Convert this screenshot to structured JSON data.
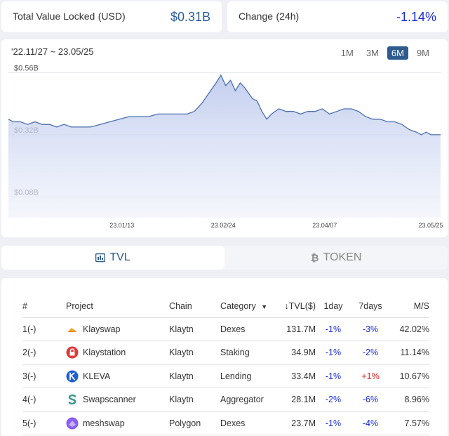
{
  "stats": {
    "tvl_label": "Total Value Locked",
    "tvl_unit": "(USD)",
    "tvl_value": "$0.31B",
    "change_label": "Change",
    "change_unit": "(24h)",
    "change_value": "-1.14%"
  },
  "chart": {
    "range_label": "'22.11/27 ~ 23.05/25",
    "periods": [
      "1M",
      "3M",
      "6M",
      "9M"
    ],
    "active_period": "6M",
    "accent": "#2d5b8f"
  },
  "chart_data": {
    "type": "area",
    "y_tick_labels": [
      "$0.56B",
      "$0.32B",
      "$0.08B"
    ],
    "y_ticks": [
      0.56,
      0.32,
      0.08
    ],
    "x_tick_labels": [
      "23.01/13",
      "23.02/24",
      "23.04/07",
      "23.05/25"
    ],
    "x_ticks": [
      "2023-01-13",
      "2023-02-24",
      "2023-04-07",
      "2023-05-25"
    ],
    "xlim": [
      "2022-11-27",
      "2023-05-25"
    ],
    "ylim": [
      0.0,
      0.58
    ],
    "grid": "horizontal",
    "series": [
      {
        "values": [
          [
            "2022-11-27",
            0.38
          ],
          [
            "2022-11-29",
            0.37
          ],
          [
            "2022-12-02",
            0.37
          ],
          [
            "2022-12-05",
            0.36
          ],
          [
            "2022-12-08",
            0.37
          ],
          [
            "2022-12-11",
            0.36
          ],
          [
            "2022-12-14",
            0.36
          ],
          [
            "2022-12-17",
            0.35
          ],
          [
            "2022-12-20",
            0.36
          ],
          [
            "2022-12-23",
            0.35
          ],
          [
            "2022-12-27",
            0.35
          ],
          [
            "2022-12-31",
            0.35
          ],
          [
            "2023-01-04",
            0.36
          ],
          [
            "2023-01-08",
            0.37
          ],
          [
            "2023-01-12",
            0.38
          ],
          [
            "2023-01-16",
            0.39
          ],
          [
            "2023-01-20",
            0.39
          ],
          [
            "2023-01-24",
            0.39
          ],
          [
            "2023-01-28",
            0.4
          ],
          [
            "2023-02-01",
            0.4
          ],
          [
            "2023-02-05",
            0.4
          ],
          [
            "2023-02-09",
            0.4
          ],
          [
            "2023-02-12",
            0.41
          ],
          [
            "2023-02-15",
            0.44
          ],
          [
            "2023-02-18",
            0.48
          ],
          [
            "2023-02-21",
            0.52
          ],
          [
            "2023-02-23",
            0.55
          ],
          [
            "2023-02-25",
            0.51
          ],
          [
            "2023-02-27",
            0.53
          ],
          [
            "2023-03-01",
            0.49
          ],
          [
            "2023-03-03",
            0.52
          ],
          [
            "2023-03-05",
            0.5
          ],
          [
            "2023-03-08",
            0.46
          ],
          [
            "2023-03-10",
            0.45
          ],
          [
            "2023-03-12",
            0.41
          ],
          [
            "2023-03-14",
            0.38
          ],
          [
            "2023-03-16",
            0.4
          ],
          [
            "2023-03-19",
            0.42
          ],
          [
            "2023-03-22",
            0.41
          ],
          [
            "2023-03-25",
            0.41
          ],
          [
            "2023-03-28",
            0.4
          ],
          [
            "2023-03-31",
            0.41
          ],
          [
            "2023-04-03",
            0.41
          ],
          [
            "2023-04-06",
            0.42
          ],
          [
            "2023-04-09",
            0.4
          ],
          [
            "2023-04-12",
            0.41
          ],
          [
            "2023-04-15",
            0.42
          ],
          [
            "2023-04-18",
            0.42
          ],
          [
            "2023-04-21",
            0.41
          ],
          [
            "2023-04-24",
            0.39
          ],
          [
            "2023-04-27",
            0.38
          ],
          [
            "2023-04-30",
            0.38
          ],
          [
            "2023-05-03",
            0.37
          ],
          [
            "2023-05-06",
            0.37
          ],
          [
            "2023-05-09",
            0.36
          ],
          [
            "2023-05-12",
            0.34
          ],
          [
            "2023-05-15",
            0.33
          ],
          [
            "2023-05-17",
            0.32
          ],
          [
            "2023-05-19",
            0.33
          ],
          [
            "2023-05-21",
            0.32
          ],
          [
            "2023-05-23",
            0.32
          ],
          [
            "2023-05-25",
            0.32
          ]
        ]
      }
    ]
  },
  "tabs": {
    "tvl_label": "TVL",
    "token_label": "TOKEN"
  },
  "table": {
    "headers": {
      "rank": "#",
      "project": "Project",
      "chain": "Chain",
      "category": "Category",
      "tvl": "TVL($)",
      "d1": "1day",
      "d7": "7days",
      "ms": "M/S"
    },
    "rows": [
      {
        "rank": "1(-)",
        "project": "Klayswap",
        "logo": "klayswap-logo",
        "chain": "Klaytn",
        "category": "Dexes",
        "tvl": "131.7M",
        "d1": "-1%",
        "d7": "-3%",
        "ms": "42.02%"
      },
      {
        "rank": "2(-)",
        "project": "Klaystation",
        "logo": "klaystation-logo",
        "chain": "Klaytn",
        "category": "Staking",
        "tvl": "34.9M",
        "d1": "-1%",
        "d7": "-2%",
        "ms": "11.14%"
      },
      {
        "rank": "3(-)",
        "project": "KLEVA",
        "logo": "kleva-logo",
        "chain": "Klaytn",
        "category": "Lending",
        "tvl": "33.4M",
        "d1": "-1%",
        "d7": "+1%",
        "ms": "10.67%"
      },
      {
        "rank": "4(-)",
        "project": "Swapscanner",
        "logo": "swapscanner-logo",
        "chain": "Klaytn",
        "category": "Aggregator",
        "tvl": "28.1M",
        "d1": "-2%",
        "d7": "-6%",
        "ms": "8.96%"
      },
      {
        "rank": "5(-)",
        "project": "meshswap",
        "logo": "meshswap-logo",
        "chain": "Polygon",
        "category": "Dexes",
        "tvl": "23.7M",
        "d1": "-1%",
        "d7": "-4%",
        "ms": "7.57%"
      }
    ]
  }
}
